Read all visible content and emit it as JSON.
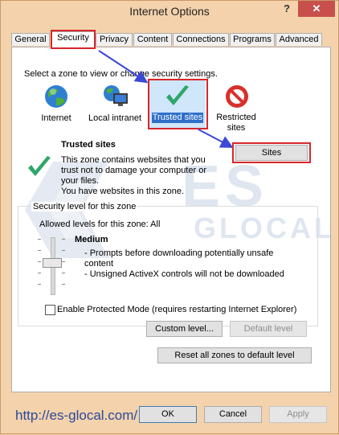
{
  "window": {
    "title": "Internet Options",
    "help_label": "?",
    "close_label": "✕"
  },
  "tabs": [
    {
      "label": "General",
      "active": false
    },
    {
      "label": "Security",
      "active": true
    },
    {
      "label": "Privacy",
      "active": false
    },
    {
      "label": "Content",
      "active": false
    },
    {
      "label": "Connections",
      "active": false
    },
    {
      "label": "Programs",
      "active": false
    },
    {
      "label": "Advanced",
      "active": false
    }
  ],
  "security": {
    "zone_prompt": "Select a zone to view or change security settings.",
    "zones": [
      {
        "label": "Internet",
        "icon": "globe-icon"
      },
      {
        "label": "Local intranet",
        "icon": "intranet-icon"
      },
      {
        "label": "Trusted sites",
        "icon": "checkmark-icon",
        "selected": true
      },
      {
        "label": "Restricted sites",
        "icon": "restricted-icon"
      }
    ],
    "sites_button": "Sites",
    "zone_title": "Trusted sites",
    "zone_description": [
      "This zone contains websites that you",
      "trust not to damage your computer or",
      "your files.",
      "You have websites in this zone."
    ]
  },
  "level": {
    "group_label": "Security level for this zone",
    "allowed_label": "Allowed levels for this zone: All",
    "level_name": "Medium",
    "bullets": [
      "- Prompts before downloading potentially unsafe",
      "content",
      "- Unsigned ActiveX controls will not be downloaded"
    ],
    "protected_mode_label": "Enable Protected Mode (requires restarting Internet Explorer)",
    "protected_mode_checked": false,
    "custom_level_button": "Custom level...",
    "default_level_button": "Default level"
  },
  "reset_all_button": "Reset all zones to default level",
  "footer": {
    "ok": "OK",
    "cancel": "Cancel",
    "apply": "Apply"
  },
  "watermark": {
    "brand_top": "ES",
    "brand_bottom": "GLOCAL",
    "url": "http://es-glocal.com/"
  },
  "colors": {
    "highlight_red": "#d7262b",
    "arrow_blue": "#3b48d8",
    "window_bg": "#f4d2ac",
    "close_red": "#c7504c"
  }
}
